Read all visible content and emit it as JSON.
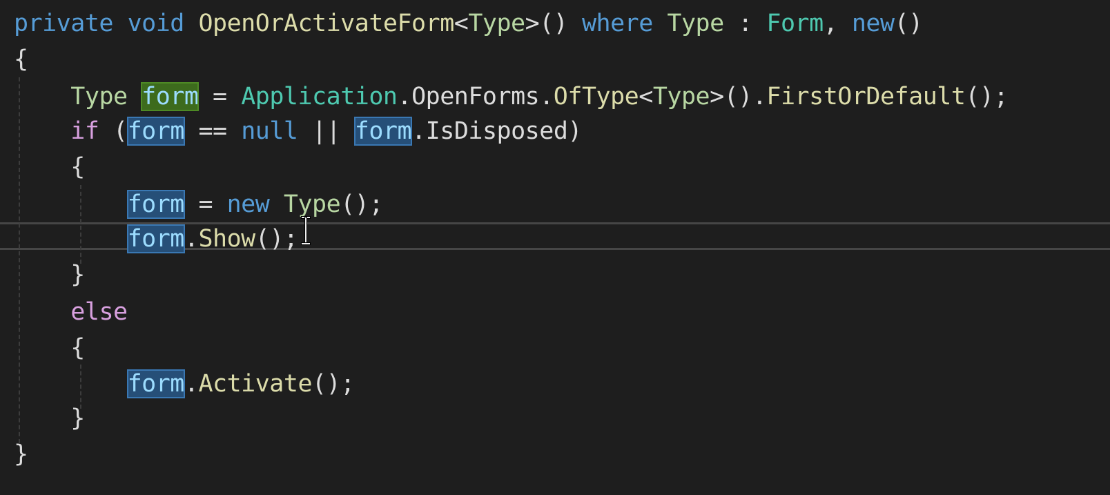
{
  "editor": {
    "theme_colors": {
      "background": "#1e1e1e",
      "keyword": "#569cd6",
      "control_keyword": "#d8a0df",
      "type": "#4ec9b0",
      "type_parameter": "#b8d7a3",
      "method": "#dcdcaa",
      "identifier": "#9cdcfe",
      "reference_highlight": "#264f78",
      "definition_highlight": "#3d6b1d"
    },
    "cursor_icon": "text-ibeam-cursor-icon",
    "lines": [
      {
        "tokens": [
          {
            "t": "private",
            "c": "kw"
          },
          {
            "t": " ",
            "c": "pl"
          },
          {
            "t": "void",
            "c": "kw"
          },
          {
            "t": " ",
            "c": "pl"
          },
          {
            "t": "OpenOrActivateForm",
            "c": "fn"
          },
          {
            "t": "<",
            "c": "pl"
          },
          {
            "t": "Type",
            "c": "tp"
          },
          {
            "t": ">",
            "c": "pl"
          },
          {
            "t": "()",
            "c": "pl"
          },
          {
            "t": " ",
            "c": "pl"
          },
          {
            "t": "where",
            "c": "kw"
          },
          {
            "t": " ",
            "c": "pl"
          },
          {
            "t": "Type",
            "c": "tp"
          },
          {
            "t": " : ",
            "c": "pl"
          },
          {
            "t": "Form",
            "c": "ty"
          },
          {
            "t": ",",
            "c": "pl"
          },
          {
            "t": " ",
            "c": "pl"
          },
          {
            "t": "new",
            "c": "kw"
          },
          {
            "t": "()",
            "c": "pl"
          }
        ]
      },
      {
        "tokens": [
          {
            "t": "{",
            "c": "pl"
          }
        ]
      },
      {
        "tokens": [
          {
            "t": "    ",
            "c": "pl"
          },
          {
            "t": "Type",
            "c": "tp"
          },
          {
            "t": " ",
            "c": "pl"
          },
          {
            "t": "form",
            "c": "var def"
          },
          {
            "t": " = ",
            "c": "pl"
          },
          {
            "t": "Application",
            "c": "ty"
          },
          {
            "t": ".",
            "c": "pl"
          },
          {
            "t": "OpenForms",
            "c": "pl"
          },
          {
            "t": ".",
            "c": "pl"
          },
          {
            "t": "OfType",
            "c": "fn"
          },
          {
            "t": "<",
            "c": "pl"
          },
          {
            "t": "Type",
            "c": "tp"
          },
          {
            "t": ">",
            "c": "pl"
          },
          {
            "t": "().",
            "c": "pl"
          },
          {
            "t": "FirstOrDefault",
            "c": "fn"
          },
          {
            "t": "();",
            "c": "pl"
          }
        ]
      },
      {
        "tokens": [
          {
            "t": "    ",
            "c": "pl"
          },
          {
            "t": "if",
            "c": "ctl"
          },
          {
            "t": " (",
            "c": "pl"
          },
          {
            "t": "form",
            "c": "var ref"
          },
          {
            "t": " == ",
            "c": "pl"
          },
          {
            "t": "null",
            "c": "kw"
          },
          {
            "t": " || ",
            "c": "pl"
          },
          {
            "t": "form",
            "c": "var ref"
          },
          {
            "t": ".",
            "c": "pl"
          },
          {
            "t": "IsDisposed",
            "c": "pl"
          },
          {
            "t": ")",
            "c": "pl"
          }
        ]
      },
      {
        "tokens": [
          {
            "t": "    ",
            "c": "pl"
          },
          {
            "t": "{",
            "c": "pl"
          }
        ]
      },
      {
        "tokens": [
          {
            "t": "        ",
            "c": "pl"
          },
          {
            "t": "form",
            "c": "var ref"
          },
          {
            "t": " = ",
            "c": "pl"
          },
          {
            "t": "new",
            "c": "kw"
          },
          {
            "t": " ",
            "c": "pl"
          },
          {
            "t": "Type",
            "c": "tp"
          },
          {
            "t": "();",
            "c": "pl"
          }
        ]
      },
      {
        "tokens": [
          {
            "t": "        ",
            "c": "pl"
          },
          {
            "t": "form",
            "c": "var ref"
          },
          {
            "t": ".",
            "c": "pl"
          },
          {
            "t": "Show",
            "c": "fn"
          },
          {
            "t": "();",
            "c": "pl"
          }
        ]
      },
      {
        "tokens": [
          {
            "t": "    ",
            "c": "pl"
          },
          {
            "t": "}",
            "c": "pl"
          }
        ]
      },
      {
        "tokens": [
          {
            "t": "    ",
            "c": "pl"
          },
          {
            "t": "else",
            "c": "ctl"
          }
        ]
      },
      {
        "tokens": [
          {
            "t": "    ",
            "c": "pl"
          },
          {
            "t": "{",
            "c": "pl"
          }
        ]
      },
      {
        "tokens": [
          {
            "t": "        ",
            "c": "pl"
          },
          {
            "t": "form",
            "c": "var ref"
          },
          {
            "t": ".",
            "c": "pl"
          },
          {
            "t": "Activate",
            "c": "fn"
          },
          {
            "t": "();",
            "c": "pl"
          }
        ]
      },
      {
        "tokens": [
          {
            "t": "    ",
            "c": "pl"
          },
          {
            "t": "}",
            "c": "pl"
          }
        ]
      },
      {
        "tokens": [
          {
            "t": "}",
            "c": "pl"
          }
        ]
      }
    ]
  }
}
